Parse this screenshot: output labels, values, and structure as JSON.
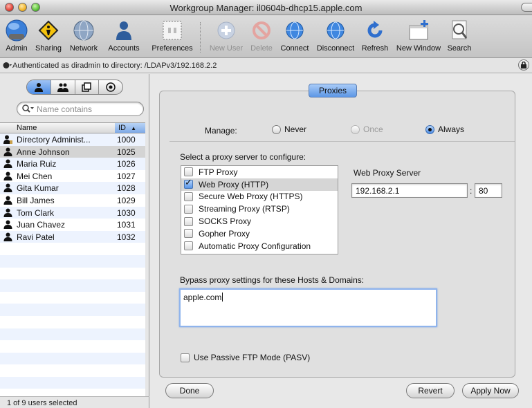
{
  "window": {
    "title": "Workgroup Manager: il0604b-dhcp15.apple.com"
  },
  "toolbar": {
    "items": [
      {
        "label": "Admin",
        "icon": "admin-globe-icon"
      },
      {
        "label": "Sharing",
        "icon": "sharing-sign-icon"
      },
      {
        "label": "Network",
        "icon": "network-globe-icon"
      },
      {
        "label": "Accounts",
        "icon": "accounts-person-icon"
      },
      {
        "label": "Preferences",
        "icon": "preferences-switch-icon"
      },
      {
        "label": "New User",
        "icon": "plus-icon",
        "disabled": true
      },
      {
        "label": "Delete",
        "icon": "delete-icon",
        "disabled": true
      },
      {
        "label": "Connect",
        "icon": "connect-icon"
      },
      {
        "label": "Disconnect",
        "icon": "disconnect-icon"
      },
      {
        "label": "Refresh",
        "icon": "refresh-icon"
      },
      {
        "label": "New Window",
        "icon": "new-window-icon"
      },
      {
        "label": "Search",
        "icon": "search-icon"
      }
    ]
  },
  "auth": {
    "text": "Authenticated as diradmin to directory: /LDAPv3/192.168.2.2"
  },
  "sidebar": {
    "search_placeholder": "Name contains",
    "columns": {
      "name": "Name",
      "id": "ID"
    },
    "users": [
      {
        "name": "Directory Administ...",
        "id": "1000"
      },
      {
        "name": "Anne Johnson",
        "id": "1025"
      },
      {
        "name": "Maria Ruiz",
        "id": "1026"
      },
      {
        "name": "Mei Chen",
        "id": "1027"
      },
      {
        "name": "Gita Kumar",
        "id": "1028"
      },
      {
        "name": "Bill James",
        "id": "1029"
      },
      {
        "name": "Tom Clark",
        "id": "1030"
      },
      {
        "name": "Juan Chavez",
        "id": "1031"
      },
      {
        "name": "Ravi Patel",
        "id": "1032"
      }
    ],
    "status": "1 of 9 users selected"
  },
  "panel": {
    "tab": "Proxies",
    "manage_label": "Manage:",
    "manage_options": [
      "Never",
      "Once",
      "Always"
    ],
    "manage_selected": "Always",
    "select_label": "Select a proxy server to configure:",
    "proxies": [
      {
        "label": "FTP Proxy",
        "checked": false
      },
      {
        "label": "Web Proxy (HTTP)",
        "checked": true
      },
      {
        "label": "Secure Web Proxy (HTTPS)",
        "checked": false
      },
      {
        "label": "Streaming Proxy (RTSP)",
        "checked": false
      },
      {
        "label": "SOCKS Proxy",
        "checked": false
      },
      {
        "label": "Gopher Proxy",
        "checked": false
      },
      {
        "label": "Automatic Proxy Configuration",
        "checked": false
      }
    ],
    "server_label": "Web Proxy Server",
    "server_host": "192.168.2.1",
    "server_port": "80",
    "bypass_label": "Bypass proxy settings for these Hosts & Domains:",
    "bypass_value": "apple.com",
    "pasv_label": "Use Passive FTP Mode (PASV)",
    "buttons": {
      "done": "Done",
      "revert": "Revert",
      "apply": "Apply Now"
    }
  }
}
